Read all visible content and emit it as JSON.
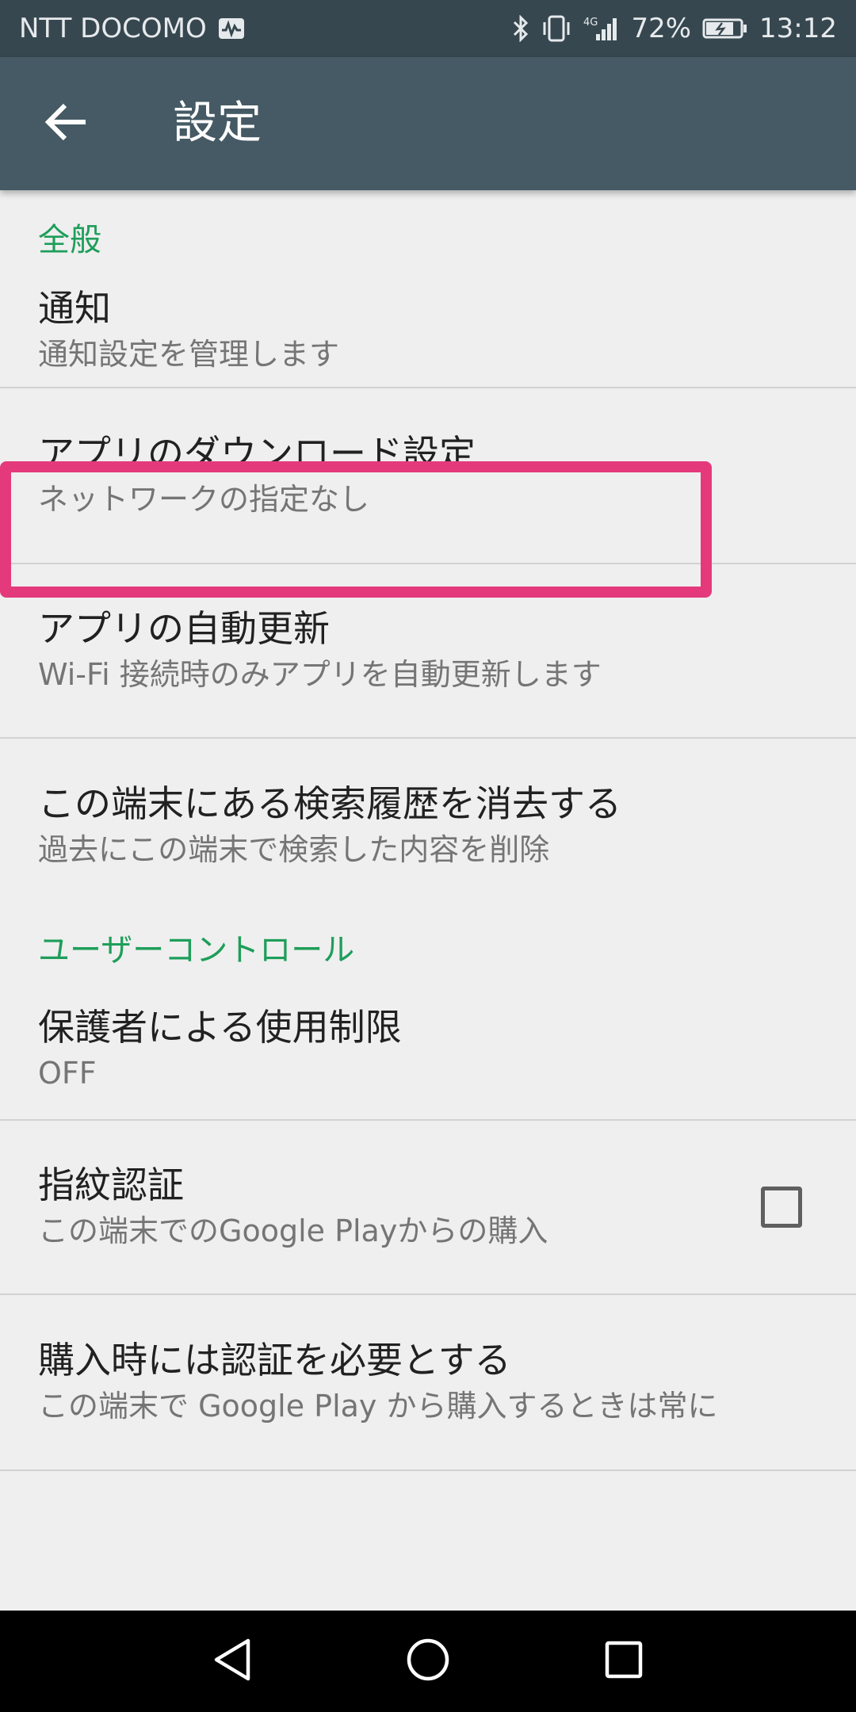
{
  "status_bar": {
    "carrier": "NTT DOCOMO",
    "network": "4G",
    "battery": "72%",
    "time": "13:12"
  },
  "app_bar": {
    "title": "設定",
    "back_icon": "arrow-back-icon"
  },
  "sections": [
    {
      "header": "全般",
      "items": [
        {
          "title": "通知",
          "subtitle": "通知設定を管理します"
        },
        {
          "title": "アプリのダウンロード設定",
          "subtitle": "ネットワークの指定なし"
        },
        {
          "title": "アプリの自動更新",
          "subtitle": "Wi-Fi 接続時のみアプリを自動更新します",
          "highlighted": true
        },
        {
          "title": "この端末にある検索履歴を消去する",
          "subtitle": "過去にこの端末で検索した内容を削除"
        }
      ]
    },
    {
      "header": "ユーザーコントロール",
      "items": [
        {
          "title": "保護者による使用制限",
          "subtitle": "OFF"
        },
        {
          "title": "指紋認証",
          "subtitle": "この端末でのGoogle Playからの購入",
          "checkbox": false
        },
        {
          "title": "購入時には認証を必要とする",
          "subtitle": "この端末で Google Play から購入するときは常に"
        }
      ]
    }
  ],
  "colors": {
    "status_bar": "#37474f",
    "app_bar": "#455a64",
    "section_header": "#1e9e5a",
    "highlight": "#e43a7b",
    "background": "#efefef"
  },
  "nav_bar": {
    "back": "nav-back-icon",
    "home": "nav-home-icon",
    "recents": "nav-recents-icon"
  }
}
